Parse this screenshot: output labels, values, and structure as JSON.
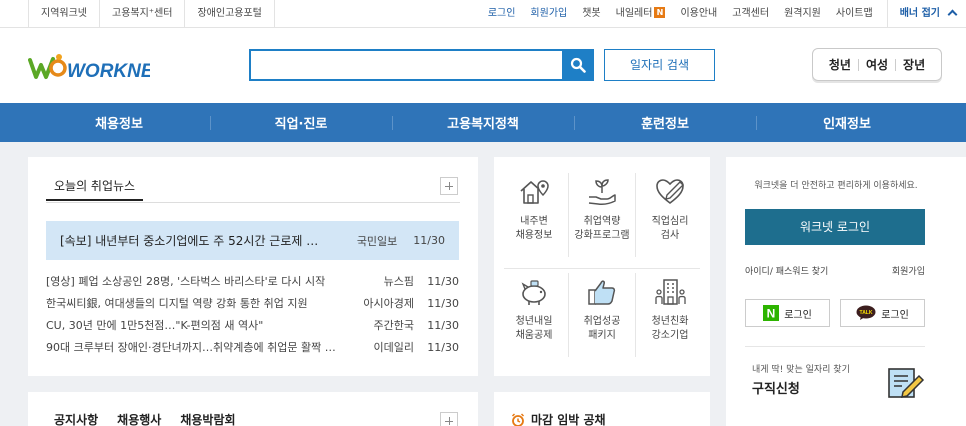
{
  "topbar": {
    "left_links": [
      "지역워크넷",
      "고용복지⁺센터",
      "장애인고용포털"
    ],
    "right_links": [
      "로그인",
      "회원가입",
      "챗봇",
      "내일레터",
      "이용안내",
      "고객센터",
      "원격지원",
      "사이트맵"
    ],
    "new_badge": "N",
    "banner_toggle": "배너 접기"
  },
  "header": {
    "logo_text": "WORKNET",
    "search_placeholder": "",
    "search_icon": "search-icon",
    "job_search_button": "일자리 검색",
    "audience": [
      "청년",
      "여성",
      "장년"
    ]
  },
  "gnb": {
    "items": [
      "채용정보",
      "직업·진로",
      "고용복지정책",
      "훈련정보",
      "인재정보"
    ]
  },
  "news": {
    "title": "오늘의 취업뉴스",
    "headline": {
      "title": "[속보] 내년부터 중소기업에도 주 52시간 근로제 …",
      "source": "국민일보",
      "date": "11/30"
    },
    "items": [
      {
        "title": "[영상] 폐업 소상공인 28명, '스타벅스 바리스타'로 다시 시작",
        "source": "뉴스핌",
        "date": "11/30"
      },
      {
        "title": "한국씨티銀, 여대생들의 디지털 역량 강화 통한 취업 지원",
        "source": "아시아경제",
        "date": "11/30"
      },
      {
        "title": "CU, 30년 만에 1만5천점…\"K-편의점 새 역사\"",
        "source": "주간한국",
        "date": "11/30"
      },
      {
        "title": "90대 크루부터 장애인·경단녀까지…취약계층에 취업문 활짝 …",
        "source": "이데일리",
        "date": "11/30"
      }
    ]
  },
  "services": [
    {
      "line1": "내주변",
      "line2": "채용정보",
      "icon": "house-location-icon"
    },
    {
      "line1": "취업역량",
      "line2": "강화프로그램",
      "icon": "sprout-hand-icon"
    },
    {
      "line1": "직업심리",
      "line2": "검사",
      "icon": "heart-pen-icon"
    },
    {
      "line1": "청년내일",
      "line2": "채움공제",
      "icon": "piggy-bank-icon"
    },
    {
      "line1": "취업성공",
      "line2": "패키지",
      "icon": "thumbs-up-icon"
    },
    {
      "line1": "청년친화",
      "line2": "강소기업",
      "icon": "building-person-icon"
    }
  ],
  "login": {
    "message": "워크넷을 더 안전하고 편리하게 이용하세요.",
    "login_button": "워크넷 로그인",
    "find_link": "아이디/ 패스워드 찾기",
    "join_link": "회원가입",
    "naver_label": "로그인",
    "naver_icon_text": "N",
    "kakao_label": "로그인",
    "kakao_icon_text": "TALK",
    "apply_sub": "내게 딱! 맞는 일자리 찾기",
    "apply_main": "구직신청"
  },
  "notice": {
    "tabs": [
      "공지사항",
      "채용행사",
      "채용박람회"
    ]
  },
  "deadline": {
    "title": "마감 임박 공채"
  },
  "colors": {
    "brand_blue": "#2f74b8",
    "search_blue": "#1e7fc6",
    "login_teal": "#1e6e8e",
    "headline_bg": "#d3e6f6",
    "logo_green": "#5ba826"
  }
}
